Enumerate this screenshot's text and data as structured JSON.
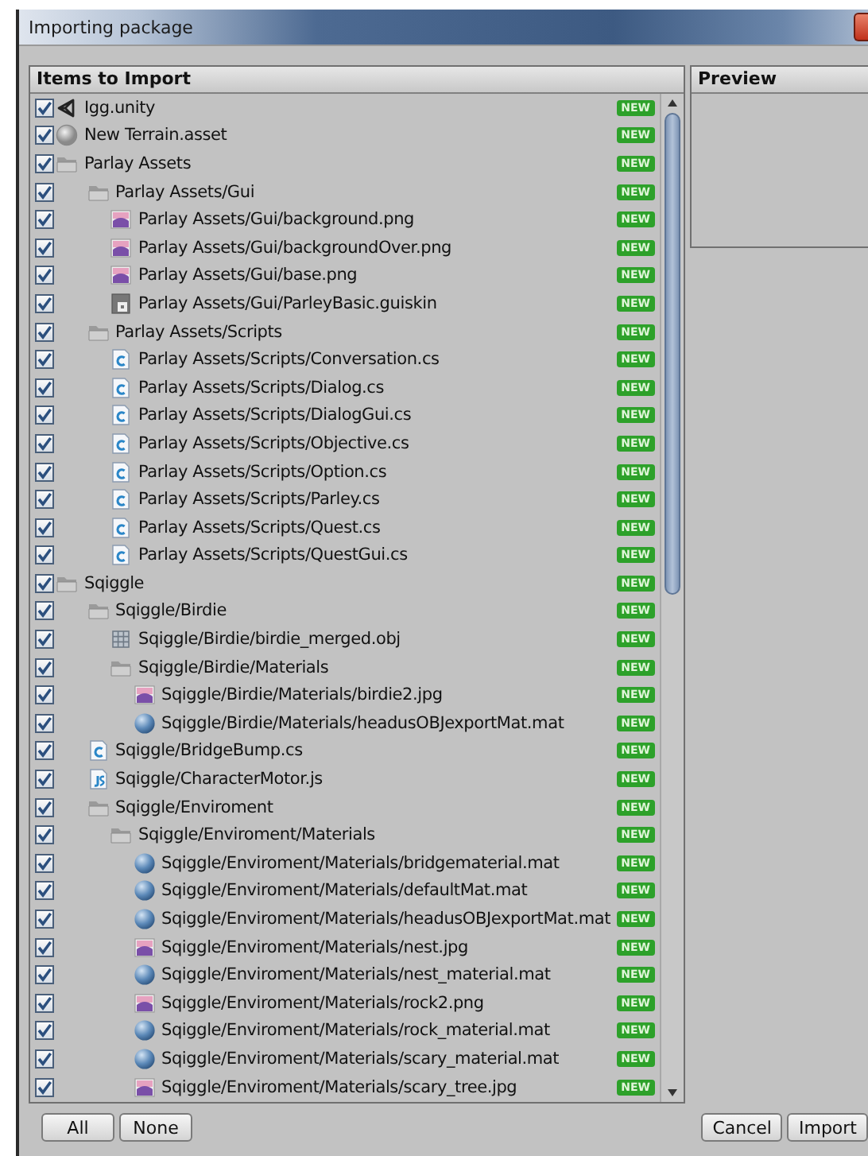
{
  "window": {
    "title": "Importing package"
  },
  "items_panel": {
    "header": "Items to Import",
    "items": [
      {
        "label": "Igg.unity",
        "kind": "scene",
        "checked": true,
        "badge": "NEW"
      },
      {
        "label": "New Terrain.asset",
        "kind": "terrain",
        "checked": true,
        "badge": "NEW"
      },
      {
        "label": "Parlay Assets",
        "kind": "folder",
        "checked": true,
        "badge": "NEW",
        "children": [
          {
            "label": "Parlay Assets/Gui",
            "kind": "folder",
            "checked": true,
            "badge": "NEW",
            "children": [
              {
                "label": "Parlay Assets/Gui/background.png",
                "kind": "image",
                "checked": true,
                "badge": "NEW"
              },
              {
                "label": "Parlay Assets/Gui/backgroundOver.png",
                "kind": "image",
                "checked": true,
                "badge": "NEW"
              },
              {
                "label": "Parlay Assets/Gui/base.png",
                "kind": "image",
                "checked": true,
                "badge": "NEW"
              },
              {
                "label": "Parlay Assets/Gui/ParleyBasic.guiskin",
                "kind": "skin",
                "checked": true,
                "badge": "NEW"
              }
            ]
          },
          {
            "label": "Parlay Assets/Scripts",
            "kind": "folder",
            "checked": true,
            "badge": "NEW",
            "children": [
              {
                "label": "Parlay Assets/Scripts/Conversation.cs",
                "kind": "csharp",
                "checked": true,
                "badge": "NEW"
              },
              {
                "label": "Parlay Assets/Scripts/Dialog.cs",
                "kind": "csharp",
                "checked": true,
                "badge": "NEW"
              },
              {
                "label": "Parlay Assets/Scripts/DialogGui.cs",
                "kind": "csharp",
                "checked": true,
                "badge": "NEW"
              },
              {
                "label": "Parlay Assets/Scripts/Objective.cs",
                "kind": "csharp",
                "checked": true,
                "badge": "NEW"
              },
              {
                "label": "Parlay Assets/Scripts/Option.cs",
                "kind": "csharp",
                "checked": true,
                "badge": "NEW"
              },
              {
                "label": "Parlay Assets/Scripts/Parley.cs",
                "kind": "csharp",
                "checked": true,
                "badge": "NEW"
              },
              {
                "label": "Parlay Assets/Scripts/Quest.cs",
                "kind": "csharp",
                "checked": true,
                "badge": "NEW"
              },
              {
                "label": "Parlay Assets/Scripts/QuestGui.cs",
                "kind": "csharp",
                "checked": true,
                "badge": "NEW"
              }
            ]
          }
        ]
      },
      {
        "label": "Sqiggle",
        "kind": "folder",
        "checked": true,
        "badge": "NEW",
        "children": [
          {
            "label": "Sqiggle/Birdie",
            "kind": "folder",
            "checked": true,
            "badge": "NEW",
            "children": [
              {
                "label": "Sqiggle/Birdie/birdie_merged.obj",
                "kind": "mesh",
                "checked": true,
                "badge": "NEW"
              },
              {
                "label": "Sqiggle/Birdie/Materials",
                "kind": "folder",
                "checked": true,
                "badge": "NEW",
                "children": [
                  {
                    "label": "Sqiggle/Birdie/Materials/birdie2.jpg",
                    "kind": "image",
                    "checked": true,
                    "badge": "NEW"
                  },
                  {
                    "label": "Sqiggle/Birdie/Materials/headusOBJexportMat.mat",
                    "kind": "material",
                    "checked": true,
                    "badge": "NEW"
                  }
                ]
              }
            ]
          },
          {
            "label": "Sqiggle/BridgeBump.cs",
            "kind": "csharp",
            "checked": true,
            "badge": "NEW"
          },
          {
            "label": "Sqiggle/CharacterMotor.js",
            "kind": "javascript",
            "checked": true,
            "badge": "NEW"
          },
          {
            "label": "Sqiggle/Enviroment",
            "kind": "folder",
            "checked": true,
            "badge": "NEW",
            "children": [
              {
                "label": "Sqiggle/Enviroment/Materials",
                "kind": "folder",
                "checked": true,
                "badge": "NEW",
                "children": [
                  {
                    "label": "Sqiggle/Enviroment/Materials/bridgematerial.mat",
                    "kind": "material",
                    "checked": true,
                    "badge": "NEW"
                  },
                  {
                    "label": "Sqiggle/Enviroment/Materials/defaultMat.mat",
                    "kind": "material",
                    "checked": true,
                    "badge": "NEW"
                  },
                  {
                    "label": "Sqiggle/Enviroment/Materials/headusOBJexportMat.mat",
                    "kind": "material",
                    "checked": true,
                    "badge": "NEW"
                  },
                  {
                    "label": "Sqiggle/Enviroment/Materials/nest.jpg",
                    "kind": "image",
                    "checked": true,
                    "badge": "NEW"
                  },
                  {
                    "label": "Sqiggle/Enviroment/Materials/nest_material.mat",
                    "kind": "material",
                    "checked": true,
                    "badge": "NEW"
                  },
                  {
                    "label": "Sqiggle/Enviroment/Materials/rock2.png",
                    "kind": "image",
                    "checked": true,
                    "badge": "NEW"
                  },
                  {
                    "label": "Sqiggle/Enviroment/Materials/rock_material.mat",
                    "kind": "material",
                    "checked": true,
                    "badge": "NEW"
                  },
                  {
                    "label": "Sqiggle/Enviroment/Materials/scary_material.mat",
                    "kind": "material",
                    "checked": true,
                    "badge": "NEW"
                  },
                  {
                    "label": "Sqiggle/Enviroment/Materials/scary_tree.jpg",
                    "kind": "image",
                    "checked": true,
                    "badge": "NEW"
                  }
                ]
              }
            ]
          }
        ]
      }
    ]
  },
  "preview_panel": {
    "header": "Preview"
  },
  "buttons_left": [
    "All",
    "None"
  ],
  "buttons_right": [
    "Cancel",
    "Import"
  ]
}
